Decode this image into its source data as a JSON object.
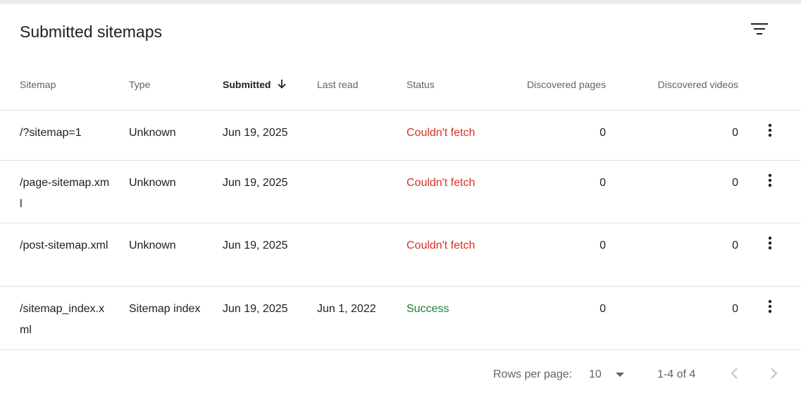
{
  "card": {
    "title": "Submitted sitemaps"
  },
  "icons": {
    "filter": "filter-list-icon",
    "more": "more-vert-icon",
    "sort": "arrow-downward-icon",
    "prev": "chevron-left-icon",
    "next": "chevron-right-icon",
    "dropdown": "arrow-drop-down-icon"
  },
  "colors": {
    "error": "#d93025",
    "success": "#188038",
    "header_text": "#5f6368",
    "divider": "#e0e0e0"
  },
  "table": {
    "columns": [
      "Sitemap",
      "Type",
      "Submitted",
      "Last read",
      "Status",
      "Discovered pages",
      "Discovered videos"
    ],
    "sorted_column": "Submitted",
    "sort_direction": "descending",
    "rows": [
      {
        "sitemap": "/?sitemap=1",
        "type": "Unknown",
        "submitted": "Jun 19, 2025",
        "last_read": "",
        "status": "Couldn't fetch",
        "status_kind": "error",
        "pages": "0",
        "videos": "0"
      },
      {
        "sitemap": "/page-sitemap.xml",
        "type": "Unknown",
        "submitted": "Jun 19, 2025",
        "last_read": "",
        "status": "Couldn't fetch",
        "status_kind": "error",
        "pages": "0",
        "videos": "0"
      },
      {
        "sitemap": "/post-sitemap.xml",
        "type": "Unknown",
        "submitted": "Jun 19, 2025",
        "last_read": "",
        "status": "Couldn't fetch",
        "status_kind": "error",
        "pages": "0",
        "videos": "0"
      },
      {
        "sitemap": "/sitemap_index.xml",
        "type": "Sitemap index",
        "submitted": "Jun 19, 2025",
        "last_read": "Jun 1, 2022",
        "status": "Success",
        "status_kind": "success",
        "pages": "0",
        "videos": "0"
      }
    ]
  },
  "pagination": {
    "rows_per_page_label": "Rows per page:",
    "rows_per_page": "10",
    "range": "1-4 of 4"
  }
}
